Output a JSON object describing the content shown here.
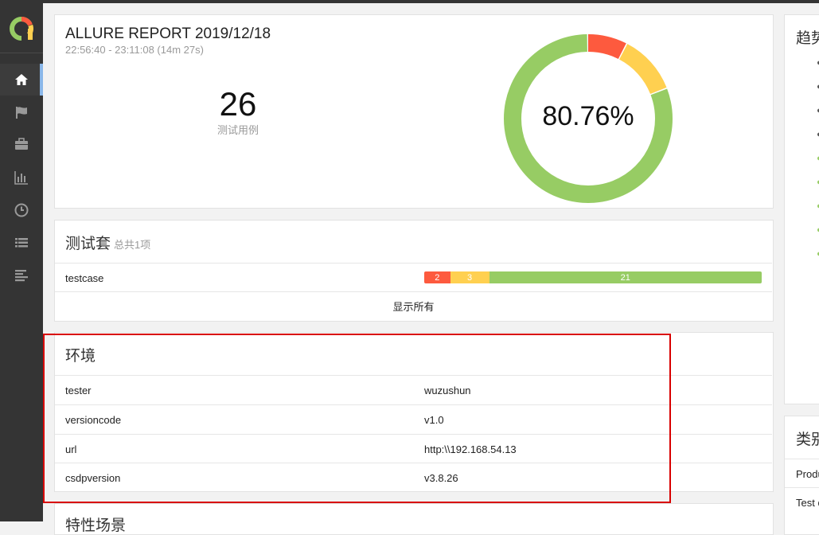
{
  "report": {
    "title": "ALLURE REPORT 2019/12/18",
    "time_range": "22:56:40 - 23:11:08 (14m 27s)",
    "test_count": "26",
    "test_count_label": "测试用例",
    "success_rate": "80.76%"
  },
  "donut": {
    "failed": 2,
    "broken": 3,
    "passed": 21
  },
  "colors": {
    "failed": "#fd5a3e",
    "broken": "#ffd050",
    "passed": "#97cc64"
  },
  "suites": {
    "title": "测试套",
    "count_label": "总共1项",
    "rows": [
      {
        "name": "testcase",
        "failed": "2",
        "broken": "3",
        "passed": "21"
      }
    ],
    "show_all": "显示所有"
  },
  "environment": {
    "title": "环境",
    "rows": [
      {
        "key": "tester",
        "value": "wuzushun"
      },
      {
        "key": "versioncode",
        "value": "v1.0"
      },
      {
        "key": "url",
        "value": "http:\\\\192.168.54.13"
      },
      {
        "key": "csdpversion",
        "value": "v3.8.26"
      }
    ]
  },
  "next_section": {
    "title": "特性场景"
  },
  "right_panel": {
    "trend_title": "趋势",
    "category_title": "类别",
    "category_rows": [
      "Produ",
      "Test d"
    ]
  },
  "nav": [
    "home-icon",
    "flag-icon",
    "briefcase-icon",
    "bar-chart-icon",
    "clock-icon",
    "list-icon",
    "timeline-icon"
  ]
}
